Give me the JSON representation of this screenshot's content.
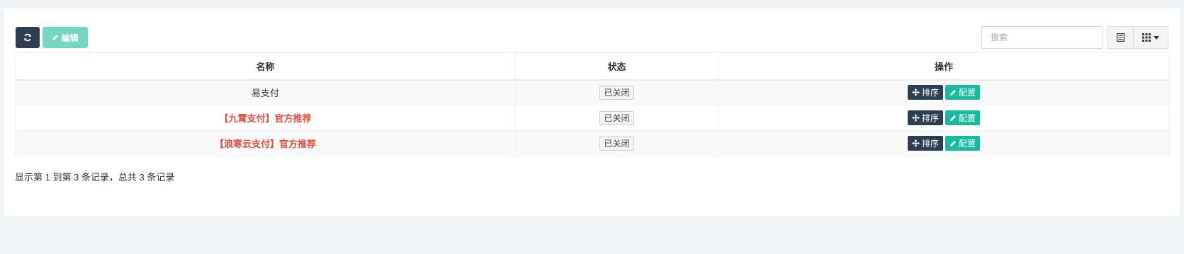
{
  "toolbar": {
    "refresh_icon": "refresh-icon",
    "edit_label": "编辑",
    "search_placeholder": "搜索"
  },
  "table": {
    "columns": [
      "名称",
      "状态",
      "操作"
    ],
    "rows": [
      {
        "name": "易支付",
        "highlight": false,
        "status": "已关闭",
        "sort_label": "排序",
        "config_label": "配置"
      },
      {
        "name": "【九霄支付】官方推荐",
        "highlight": true,
        "status": "已关闭",
        "sort_label": "排序",
        "config_label": "配置"
      },
      {
        "name": "【浪寒云支付】官方推荐",
        "highlight": true,
        "status": "已关闭",
        "sort_label": "排序",
        "config_label": "配置"
      }
    ]
  },
  "pagination": {
    "info": "显示第 1 到第 3 条记录，总共 3 条记录"
  },
  "colors": {
    "primary": "#2c3e50",
    "success": "#18bc9c",
    "danger": "#e74c3c"
  }
}
